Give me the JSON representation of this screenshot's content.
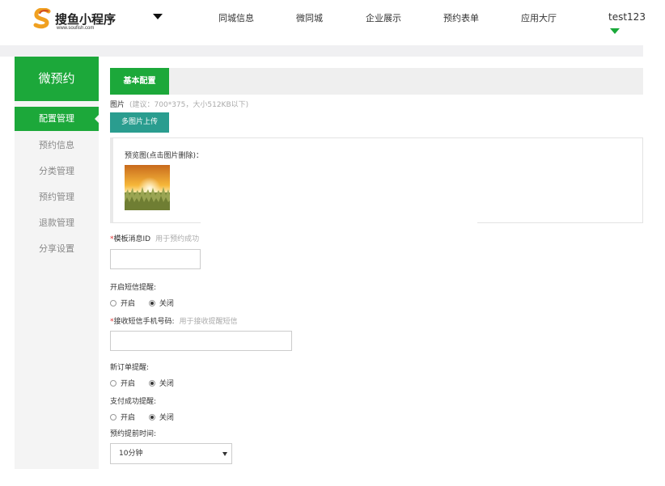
{
  "brand": {
    "name": "搜鱼小程序",
    "site": "www.soufish.com"
  },
  "nav": {
    "items": [
      "同城信息",
      "微同城",
      "企业展示",
      "预约表单",
      "应用大厅"
    ],
    "user": "test123"
  },
  "sidebar": {
    "title": "微预约",
    "items": [
      {
        "label": "配置管理",
        "active": true
      },
      {
        "label": "预约信息"
      },
      {
        "label": "分类管理"
      },
      {
        "label": "预约管理"
      },
      {
        "label": "退款管理"
      },
      {
        "label": "分享设置"
      }
    ]
  },
  "main": {
    "tab": "基本配置",
    "image": {
      "label": "图片",
      "hint": "(建议：700*375，大小512KB以下)"
    },
    "upload_button": "多图片上传",
    "preview_label": "预览图(点击图片删除)：",
    "template": {
      "label": "模板消息ID",
      "hint": "用于预约成功",
      "value": ""
    },
    "sms_reminder": {
      "label": "开启短信提醒:",
      "options": [
        "开启",
        "关闭"
      ],
      "selected": "关闭"
    },
    "sms_phone": {
      "label": "接收短信手机号码:",
      "hint": "用于接收提醒短信",
      "value": ""
    },
    "new_order": {
      "label": "新订单提醒:",
      "options": [
        "开启",
        "关闭"
      ],
      "selected": "关闭"
    },
    "pay_success": {
      "label": "支付成功提醒:",
      "options": [
        "开启",
        "关闭"
      ],
      "selected": "关闭"
    },
    "advance_time": {
      "label": "预约提前时间:",
      "value": "10分钟"
    }
  },
  "colors": {
    "accent": "#1ca83a",
    "upload": "#2a9d8f",
    "required": "#e03131"
  }
}
